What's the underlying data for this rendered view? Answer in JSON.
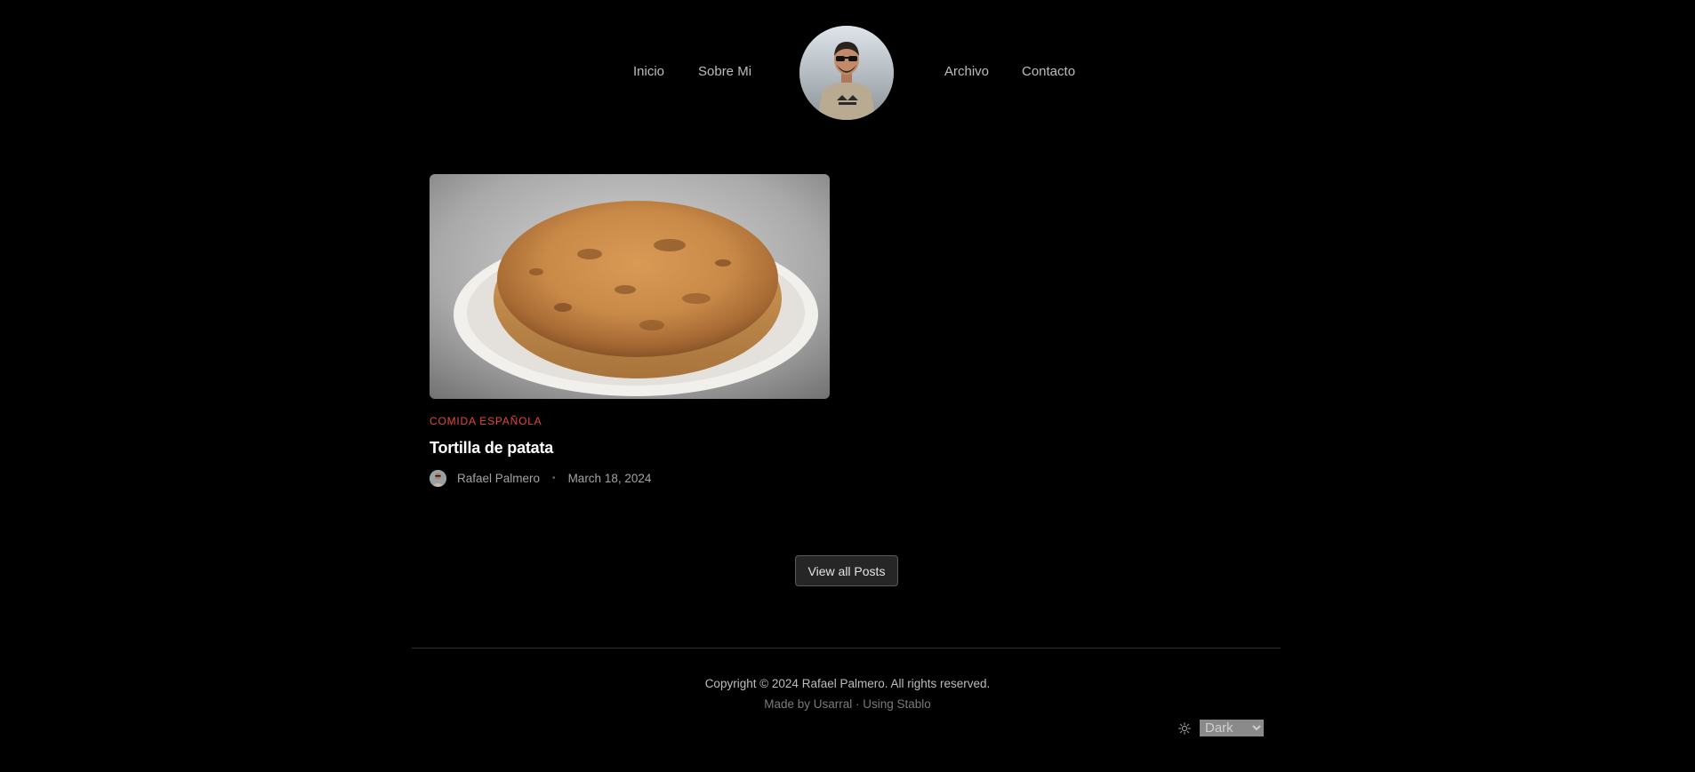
{
  "nav": {
    "left": [
      {
        "label": "Inicio"
      },
      {
        "label": "Sobre Mi"
      }
    ],
    "right": [
      {
        "label": "Archivo"
      },
      {
        "label": "Contacto"
      }
    ],
    "avatar_icon": "profile-photo"
  },
  "post": {
    "category": "COMIDA ESPAÑOLA",
    "title": "Tortilla de patata",
    "author": "Rafael Palmero",
    "separator": "•",
    "date": "March 18, 2024",
    "accent_color": "#e0483d"
  },
  "view_all": {
    "label": "View all Posts"
  },
  "footer": {
    "copyright": "Copyright © 2024 Rafael Palmero. All rights reserved.",
    "made_by_prefix": "Made by ",
    "made_by_link": "Usarral",
    "made_by_sep": " · ",
    "using_link": "Using Stablo",
    "theme_icon": "sun-icon",
    "theme_selected": "Dark"
  }
}
